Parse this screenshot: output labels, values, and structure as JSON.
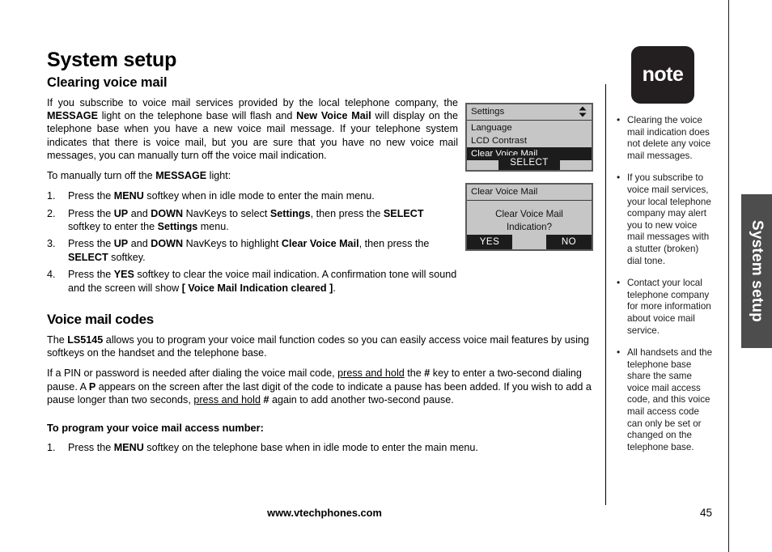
{
  "chapter_tab": {
    "label": "System setup"
  },
  "main": {
    "title": "System setup",
    "section1_heading": "Clearing voice mail",
    "intro_p1_a": "If you subscribe to voice mail services provided by the local telephone company, the ",
    "intro_p1_b": "MESSAGE",
    "intro_p1_c": " light on the telephone base will flash and ",
    "intro_p1_d": "New Voice Mail",
    "intro_p1_e": " will display on the telephone base when you have a new voice mail message. If your telephone system indicates that there is voice mail, but you are sure that you have no new voice mail messages, you can manually turn off the voice mail indication.",
    "intro_p2_a": "To manually turn off the ",
    "intro_p2_b": "MESSAGE",
    "intro_p2_c": " light:",
    "steps": [
      {
        "num": "1.",
        "parts": [
          {
            "t": "Press the ",
            "b": false
          },
          {
            "t": "MENU",
            "b": true
          },
          {
            "t": " softkey when in idle mode to enter the main menu.",
            "b": false
          }
        ]
      },
      {
        "num": "2.",
        "parts": [
          {
            "t": "Press the ",
            "b": false
          },
          {
            "t": "UP",
            "b": true
          },
          {
            "t": " and ",
            "b": false
          },
          {
            "t": "DOWN",
            "b": true
          },
          {
            "t": " NavKeys to select ",
            "b": false
          },
          {
            "t": "Settings",
            "b": true
          },
          {
            "t": ", then press the ",
            "b": false
          },
          {
            "t": "SELECT",
            "b": true
          },
          {
            "t": " softkey to enter the ",
            "b": false
          },
          {
            "t": "Settings",
            "b": true
          },
          {
            "t": " menu.",
            "b": false
          }
        ]
      },
      {
        "num": "3.",
        "parts": [
          {
            "t": "Press the ",
            "b": false
          },
          {
            "t": "UP",
            "b": true
          },
          {
            "t": " and ",
            "b": false
          },
          {
            "t": "DOWN",
            "b": true
          },
          {
            "t": " NavKeys to highlight ",
            "b": false
          },
          {
            "t": "Clear Voice Mail",
            "b": true
          },
          {
            "t": ", then press the ",
            "b": false
          },
          {
            "t": "SELECT",
            "b": true
          },
          {
            "t": " softkey.",
            "b": false
          }
        ]
      },
      {
        "num": "4.",
        "parts": [
          {
            "t": "Press the ",
            "b": false
          },
          {
            "t": "YES",
            "b": true
          },
          {
            "t": " softkey to clear the voice mail indication. A confirmation tone will sound and the screen will show ",
            "b": false
          },
          {
            "t": "[ Voice Mail Indication cleared ]",
            "b": true
          },
          {
            "t": ".",
            "b": false
          }
        ]
      }
    ],
    "section2_heading": "Voice mail codes",
    "p3_a": "The ",
    "p3_b": "LS5145",
    "p3_c": " allows you to program your voice mail function codes so you can easily access voice mail features by using softkeys on the handset and the telephone base.",
    "p4_a": "If a PIN or password is needed after dialing the voice mail code, ",
    "p4_u1": "press and hold",
    "p4_b": " the ",
    "p4_hash1": "#",
    "p4_c": " key to enter a two-second dialing pause. A ",
    "p4_p": "P",
    "p4_d": " appears on the screen after the last digit of the code to indicate a pause has been added. If you wish to add a pause longer than two seconds, ",
    "p4_u2": "press and hold",
    "p4_hash2": "#",
    "p4_e": " again to add another two-second pause.",
    "subsection_heading": "To program your voice mail access number:",
    "steps2": [
      {
        "num": "1.",
        "parts": [
          {
            "t": "Press the ",
            "b": false
          },
          {
            "t": "MENU",
            "b": true
          },
          {
            "t": " softkey on the telephone base when in idle mode to enter the main menu.",
            "b": false
          }
        ]
      }
    ]
  },
  "lcd_settings": {
    "title": "Settings",
    "arrow_icon": "↕",
    "items": [
      {
        "label": "Language",
        "selected": false
      },
      {
        "label": "LCD Contrast",
        "selected": false
      },
      {
        "label": "Clear Voice Mail",
        "selected": true
      }
    ],
    "softkey": "SELECT"
  },
  "lcd_confirm": {
    "title": "Clear Voice Mail",
    "body_line1": "Clear Voice Mail",
    "body_line2": "Indication?",
    "softkey_left": "YES",
    "softkey_right": "NO"
  },
  "note": {
    "badge_label": "note",
    "bullet_glyph": "•",
    "items": [
      "Clearing the voice mail indication does not delete any voice mail messages.",
      "If you subscribe to voice mail services, your local telephone company may alert you to new voice mail messages with a stutter (broken) dial tone.",
      "Contact your local telephone company for more information about voice mail service.",
      "All handsets and the telephone base share the same voice mail access code, and this voice mail access code can only be set or changed on the telephone base."
    ]
  },
  "footer": {
    "url": "www.vtechphones.com",
    "page_number": "45"
  },
  "colors": {
    "tab_bg": "#4d4d4d",
    "note_badge_bg": "#231f20",
    "lcd_bg": "#c6c6c6",
    "lcd_border": "#5b5b5b",
    "lcd_highlight": "#1c1c1c"
  }
}
